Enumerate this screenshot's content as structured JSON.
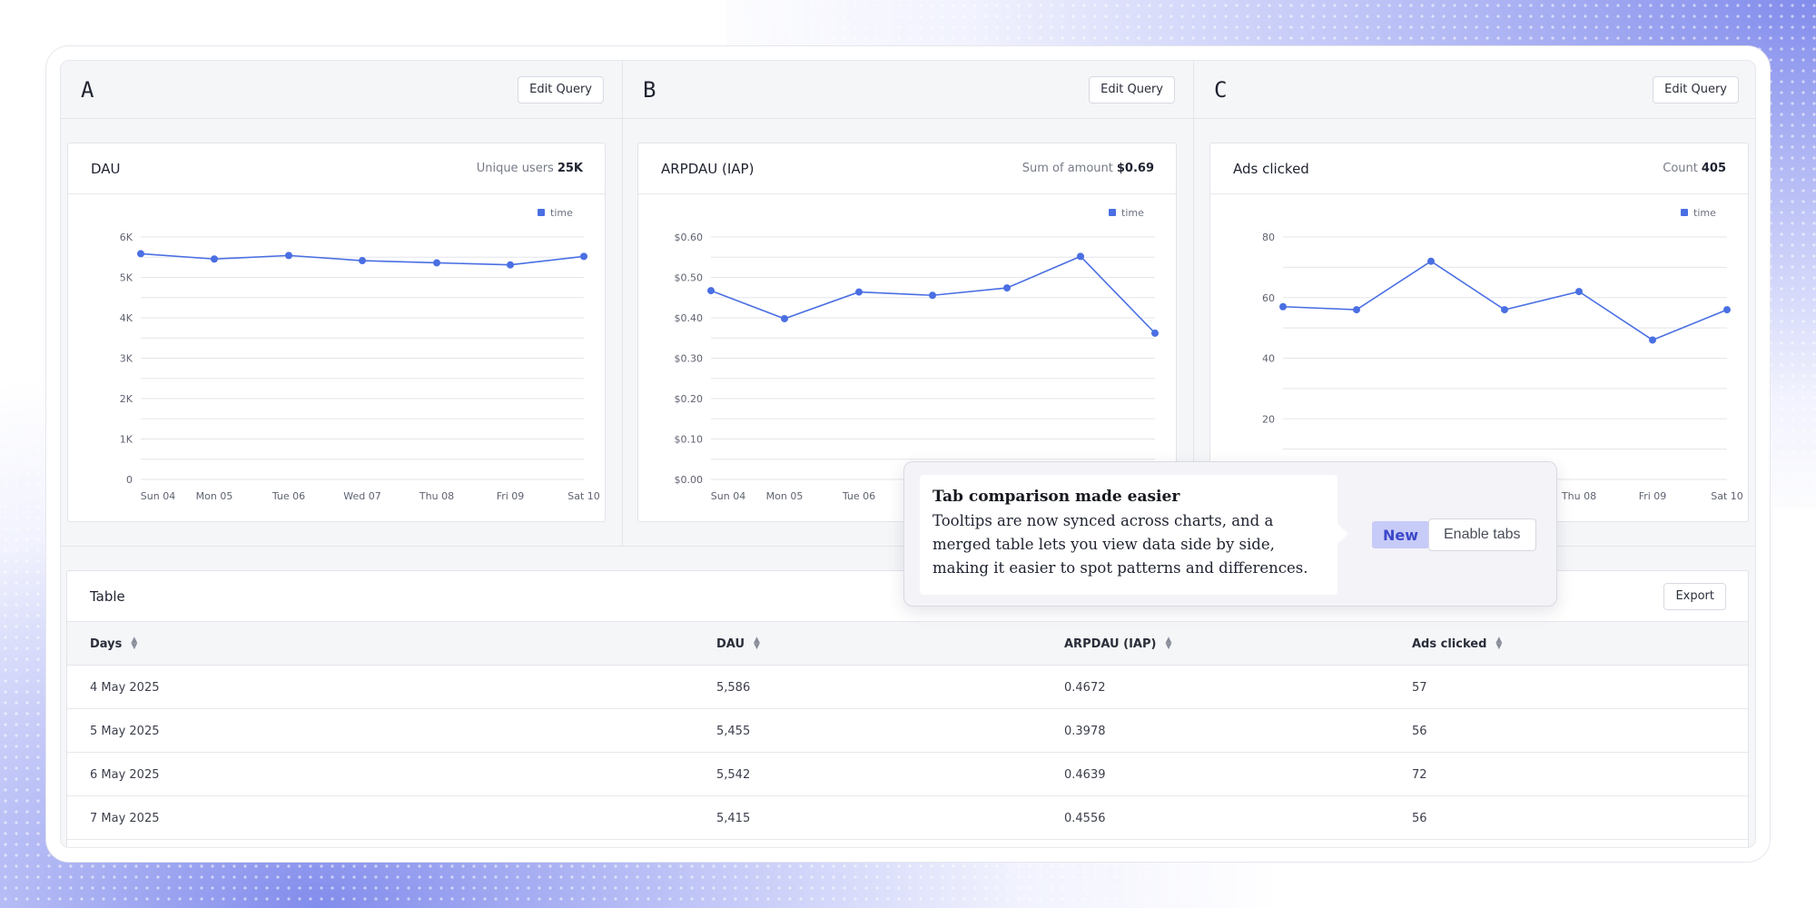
{
  "columns": [
    {
      "letter": "A",
      "edit_label": "Edit Query",
      "card_title": "DAU",
      "stat_label": "Unique users",
      "stat_value": "25K"
    },
    {
      "letter": "B",
      "edit_label": "Edit Query",
      "card_title": "ARPDAU (IAP)",
      "stat_label": "Sum of amount",
      "stat_value": "$0.69"
    },
    {
      "letter": "C",
      "edit_label": "Edit Query",
      "card_title": "Ads clicked",
      "stat_label": "Count",
      "stat_value": "405"
    }
  ],
  "colors": {
    "series": "#4a6fe3",
    "grid": "#e4e5ea",
    "accent": "#3c48c9"
  },
  "chart_data": [
    {
      "type": "line",
      "categories": [
        "Sun 04",
        "Mon 05",
        "Tue 06",
        "Wed 07",
        "Thu 08",
        "Fri 09",
        "Sat 10"
      ],
      "series": [
        {
          "name": "time",
          "values": [
            5586,
            5455,
            5542,
            5415,
            5360,
            5310,
            5520
          ]
        }
      ],
      "ylim": [
        0,
        6000
      ],
      "yticks": [
        0,
        1000,
        2000,
        3000,
        4000,
        5000,
        6000
      ],
      "ytick_labels": [
        "0",
        "1K",
        "2K",
        "3K",
        "4K",
        "5K",
        "6K"
      ],
      "grid": true,
      "legend": "top-right"
    },
    {
      "type": "line",
      "categories": [
        "Sun 04",
        "Mon 05",
        "Tue 06",
        "Wed 07",
        "Thu 08",
        "Fri 09",
        "Sat 10"
      ],
      "series": [
        {
          "name": "time",
          "values": [
            0.4672,
            0.3978,
            0.4639,
            0.4556,
            0.474,
            0.552,
            0.362
          ]
        }
      ],
      "ylim": [
        0,
        0.6
      ],
      "yticks": [
        0,
        0.1,
        0.2,
        0.3,
        0.4,
        0.5,
        0.6
      ],
      "ytick_labels": [
        "$0.00",
        "$0.10",
        "$0.20",
        "$0.30",
        "$0.40",
        "$0.50",
        "$0.60"
      ],
      "visible_xtick_labels": [
        "Sun 04",
        "Mon 05",
        "Tue 06"
      ],
      "grid": true,
      "legend": "top-right"
    },
    {
      "type": "line",
      "categories": [
        "Sun 04",
        "Mon 05",
        "Tue 06",
        "Wed 07",
        "Thu 08",
        "Fri 09",
        "Sat 10"
      ],
      "series": [
        {
          "name": "time",
          "values": [
            57,
            56,
            72,
            56,
            62,
            46,
            56
          ]
        }
      ],
      "ylim": [
        0,
        80
      ],
      "yticks": [
        20,
        40,
        60,
        80
      ],
      "ytick_labels": [
        "20",
        "40",
        "60",
        "80"
      ],
      "visible_xtick_labels": [
        "Thu 08",
        "Fri 09",
        "Sat 10"
      ],
      "grid": true,
      "legend": "top-right"
    }
  ],
  "table": {
    "title": "Table",
    "export_label": "Export",
    "headers": [
      "Days",
      "DAU",
      "ARPDAU (IAP)",
      "Ads clicked"
    ],
    "rows": [
      [
        "4 May 2025",
        "5,586",
        "0.4672",
        "57"
      ],
      [
        "5 May 2025",
        "5,455",
        "0.3978",
        "56"
      ],
      [
        "6 May 2025",
        "5,542",
        "0.4639",
        "72"
      ],
      [
        "7 May 2025",
        "5,415",
        "0.4556",
        "56"
      ]
    ]
  },
  "popover": {
    "title": "Tab comparison made easier",
    "text": "Tooltips are now synced across charts, and a merged table lets you view data side by side, making it easier to spot patterns and differences.",
    "badge": "New",
    "button": "Enable tabs"
  }
}
